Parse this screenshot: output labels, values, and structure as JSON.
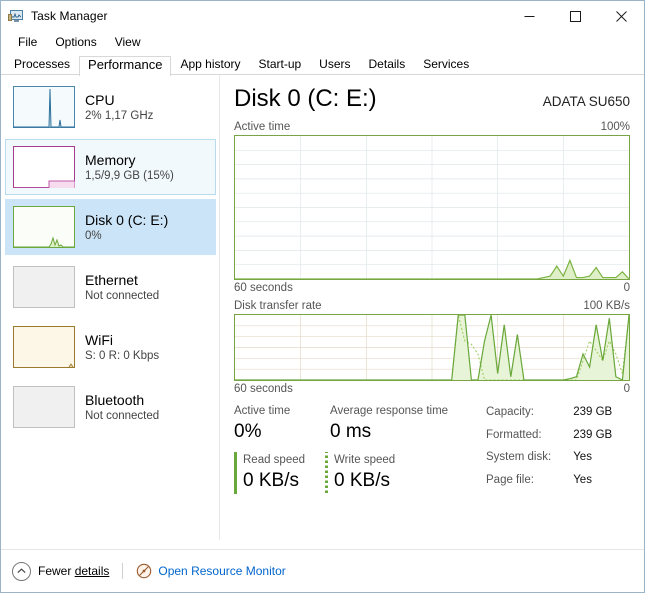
{
  "window": {
    "title": "Task Manager",
    "icon": "task-manager-icon",
    "minimize_label": "Minimize",
    "maximize_label": "Maximize",
    "close_label": "Close"
  },
  "menu": {
    "items": [
      {
        "label": "File"
      },
      {
        "label": "Options"
      },
      {
        "label": "View"
      }
    ]
  },
  "tabs": {
    "active": "Performance",
    "items": [
      {
        "label": "Processes"
      },
      {
        "label": "Performance"
      },
      {
        "label": "App history"
      },
      {
        "label": "Start-up"
      },
      {
        "label": "Users"
      },
      {
        "label": "Details"
      },
      {
        "label": "Services"
      }
    ]
  },
  "sidebar": {
    "items": [
      {
        "title": "CPU",
        "subtitle": "2%  1,17 GHz",
        "state": "normal",
        "accent": "#3a7ca5"
      },
      {
        "title": "Memory",
        "subtitle": "1,5/9,9 GB (15%)",
        "state": "hover",
        "accent": "#a63a8c"
      },
      {
        "title": "Disk 0 (C: E:)",
        "subtitle": "0%",
        "state": "selected",
        "accent": "#6aa83c"
      },
      {
        "title": "Ethernet",
        "subtitle": "Not connected",
        "state": "normal",
        "accent": "#b0b0b0"
      },
      {
        "title": "WiFi",
        "subtitle": "S: 0 R: 0 Kbps",
        "state": "normal",
        "accent": "#9a7b2e"
      },
      {
        "title": "Bluetooth",
        "subtitle": "Not connected",
        "state": "normal",
        "accent": "#b0b0b0"
      }
    ]
  },
  "main": {
    "title": "Disk 0 (C: E:)",
    "model": "ADATA SU650"
  },
  "chart_data": [
    {
      "type": "area",
      "name": "active-time-graph",
      "title": "Active time",
      "ymax_label": "100%",
      "ymin_label": "0",
      "xlabel": "60 seconds",
      "ylim": [
        0,
        100
      ],
      "xlim": [
        0,
        60
      ],
      "grid": true,
      "grid_rows": 10,
      "grid_cols": 6,
      "line_color": "#7cb342",
      "fill_color": "#dff0c8",
      "x": [
        0,
        2,
        4,
        6,
        8,
        10,
        12,
        14,
        16,
        18,
        20,
        22,
        24,
        26,
        28,
        30,
        32,
        34,
        36,
        38,
        40,
        42,
        44,
        46,
        47,
        48,
        49,
        50,
        51,
        52,
        53,
        54,
        55,
        56,
        57,
        58,
        59,
        60
      ],
      "values": [
        0,
        0,
        0,
        0,
        0,
        0,
        0,
        0,
        0,
        0,
        0,
        0,
        0,
        0,
        0,
        0,
        0,
        0,
        0,
        0,
        0,
        0,
        0,
        0,
        1,
        2,
        9,
        2,
        13,
        1,
        1,
        2,
        8,
        1,
        1,
        1,
        5,
        0
      ]
    },
    {
      "type": "area",
      "name": "disk-transfer-rate-graph",
      "title": "Disk transfer rate",
      "ymax_label": "100 KB/s",
      "ymin_label": "0",
      "xlabel": "60 seconds",
      "ylim": [
        0,
        100
      ],
      "xlim": [
        0,
        60
      ],
      "grid": true,
      "grid_rows": 6,
      "grid_cols": 6,
      "read_color": "#6aa83c",
      "write_color": "#9ccc5a",
      "fill_color": "#e8f4d8",
      "x": [
        0,
        5,
        10,
        15,
        20,
        25,
        30,
        33,
        34,
        35,
        36,
        37,
        38,
        39,
        40,
        41,
        42,
        43,
        44,
        45,
        46,
        47,
        48,
        49,
        50,
        51,
        52,
        53,
        54,
        55,
        56,
        57,
        58,
        59,
        60
      ],
      "read_values": [
        0,
        0,
        0,
        0,
        0,
        0,
        0,
        0,
        100,
        100,
        0,
        0,
        60,
        100,
        10,
        85,
        5,
        70,
        0,
        0,
        0,
        0,
        0,
        0,
        0,
        2,
        5,
        40,
        20,
        85,
        30,
        95,
        5,
        0,
        100
      ],
      "write_values": [
        0,
        0,
        0,
        0,
        0,
        0,
        0,
        0,
        100,
        60,
        55,
        40,
        0,
        0,
        0,
        0,
        0,
        0,
        0,
        0,
        0,
        0,
        0,
        0,
        0,
        0,
        0,
        30,
        60,
        45,
        30,
        60,
        40,
        10,
        100
      ]
    }
  ],
  "stats": {
    "active_time": {
      "label": "Active time",
      "value": "0%"
    },
    "avg_response": {
      "label": "Average response time",
      "value": "0 ms"
    },
    "read_speed": {
      "label": "Read speed",
      "value": "0 KB/s"
    },
    "write_speed": {
      "label": "Write speed",
      "value": "0 KB/s"
    },
    "info": [
      {
        "key": "Capacity:",
        "value": "239 GB"
      },
      {
        "key": "Formatted:",
        "value": "239 GB"
      },
      {
        "key": "System disk:",
        "value": "Yes"
      },
      {
        "key": "Page file:",
        "value": "Yes"
      }
    ]
  },
  "statusbar": {
    "fewer_details_prefix": "Fewer ",
    "fewer_details_underlined": "details",
    "resource_monitor": "Open Resource Monitor",
    "link_color": "#0066cc"
  }
}
